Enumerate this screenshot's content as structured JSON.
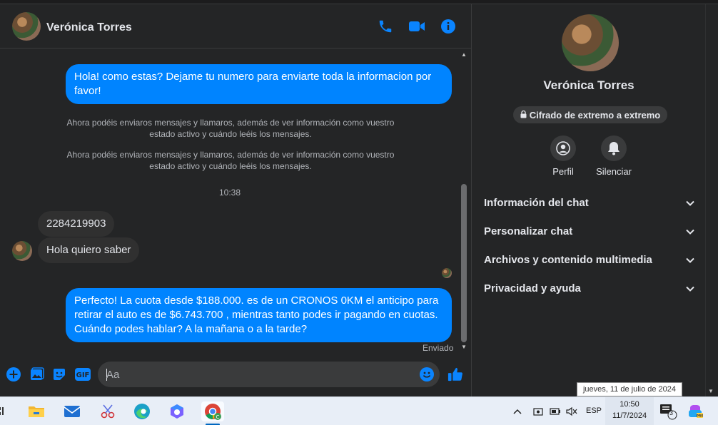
{
  "chat": {
    "contact_name": "Verónica Torres",
    "messages": {
      "out1": "Hola! como estas? Dejame tu numero para enviarte toda la informacion por favor!",
      "sys1": "Ahora podéis enviaros mensajes y llamaros, además de ver información como vuestro estado activo y cuándo leéis los mensajes.",
      "sys2": "Ahora podéis enviaros mensajes y llamaros, además de ver información como vuestro estado activo y cuándo leéis los mensajes.",
      "time": "10:38",
      "in1": "2284219903",
      "in2": "Hola quiero saber",
      "out2": "Perfecto! La cuota desde $188.000. es de un CRONOS 0KM el anticipo para retirar el auto es de $6.743.700 , mientras tanto podes ir pagando en cuotas. Cuándo podes hablar? A la mañana o a la tarde?",
      "status": "Enviado"
    },
    "composer_placeholder": "Aa",
    "icons": [
      "phone-icon",
      "video-icon",
      "info-icon",
      "plus-icon",
      "image-icon",
      "sticker-icon",
      "gif-icon",
      "emoji-icon",
      "like-icon"
    ]
  },
  "panel": {
    "name": "Verónica Torres",
    "encryption": "Cifrado de extremo a extremo",
    "actions": [
      {
        "label": "Perfil"
      },
      {
        "label": "Silenciar"
      }
    ],
    "sections": [
      {
        "label": "Información del chat"
      },
      {
        "label": "Personalizar chat"
      },
      {
        "label": "Archivos y contenido multimedia"
      },
      {
        "label": "Privacidad y ayuda"
      }
    ]
  },
  "taskbar": {
    "lang": "ESP",
    "time": "10:50",
    "date": "11/7/2024",
    "notification_count": "3",
    "tooltip": "jueves, 11 de julio de 2024"
  },
  "colors": {
    "accent": "#0084ff",
    "background": "#242526",
    "bubble_in": "#303030"
  }
}
